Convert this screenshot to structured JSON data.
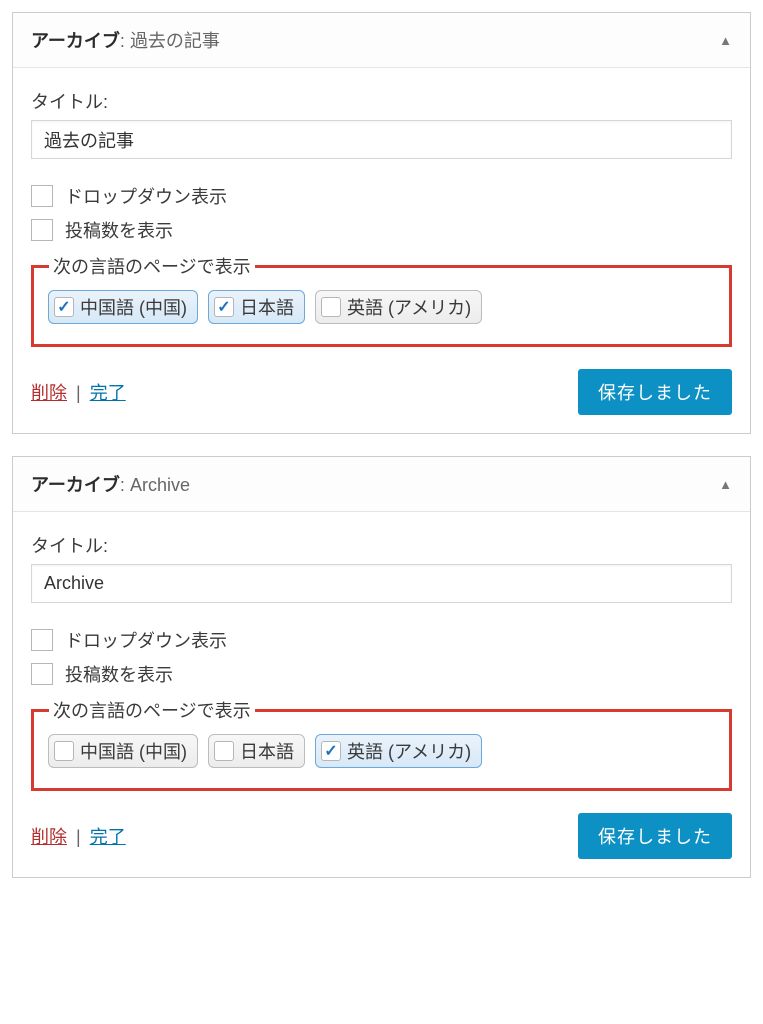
{
  "widgets": [
    {
      "header_prefix": "アーカイブ",
      "header_suffix": "過去の記事",
      "title_label": "タイトル:",
      "title_value": "過去の記事",
      "options": {
        "dropdown": {
          "label": "ドロップダウン表示",
          "checked": false
        },
        "show_count": {
          "label": "投稿数を表示",
          "checked": false
        }
      },
      "lang_legend": "次の言語のページで表示",
      "languages": [
        {
          "label": "中国語 (中国)",
          "checked": true
        },
        {
          "label": "日本語",
          "checked": true
        },
        {
          "label": "英語 (アメリカ)",
          "checked": false
        }
      ],
      "footer": {
        "delete": "削除",
        "done": "完了",
        "saved": "保存しました"
      }
    },
    {
      "header_prefix": "アーカイブ",
      "header_suffix": "Archive",
      "title_label": "タイトル:",
      "title_value": "Archive",
      "options": {
        "dropdown": {
          "label": "ドロップダウン表示",
          "checked": false
        },
        "show_count": {
          "label": "投稿数を表示",
          "checked": false
        }
      },
      "lang_legend": "次の言語のページで表示",
      "languages": [
        {
          "label": "中国語 (中国)",
          "checked": false
        },
        {
          "label": "日本語",
          "checked": false
        },
        {
          "label": "英語 (アメリカ)",
          "checked": true
        }
      ],
      "footer": {
        "delete": "削除",
        "done": "完了",
        "saved": "保存しました"
      }
    }
  ]
}
